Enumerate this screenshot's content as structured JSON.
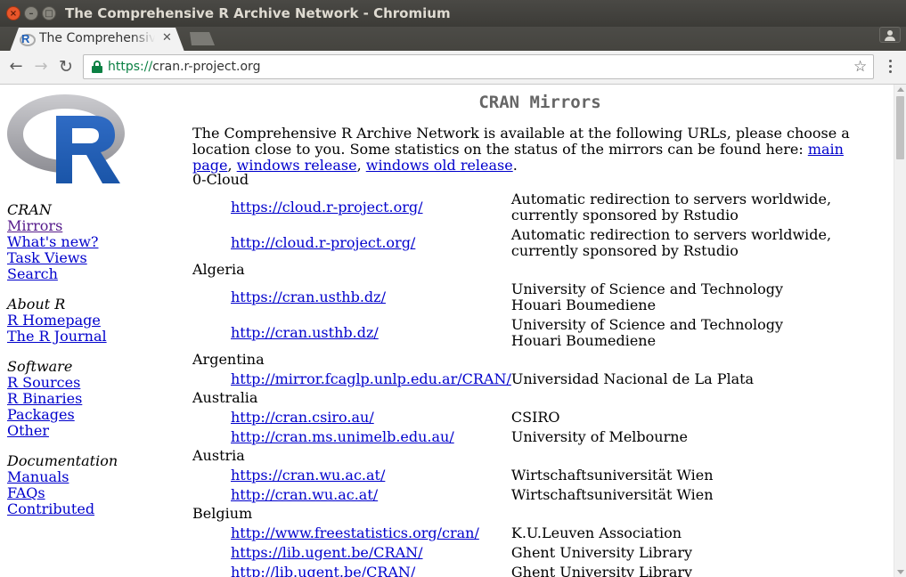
{
  "window": {
    "title": "The Comprehensive R Archive Network - Chromium"
  },
  "tab": {
    "title": "The Comprehensive R Archive Network",
    "favicon": "R"
  },
  "toolbar": {
    "url_scheme": "https://",
    "url_host": "cran.r-project.org"
  },
  "sidebar": {
    "groups": [
      {
        "heading": "CRAN",
        "links": [
          "Mirrors",
          "What's new?",
          "Task Views",
          "Search"
        ]
      },
      {
        "heading": "About R",
        "links": [
          "R Homepage",
          "The R Journal"
        ]
      },
      {
        "heading": "Software",
        "links": [
          "R Sources",
          "R Binaries",
          "Packages",
          "Other"
        ]
      },
      {
        "heading": "Documentation",
        "links": [
          "Manuals",
          "FAQs",
          "Contributed"
        ]
      }
    ]
  },
  "main": {
    "title": "CRAN Mirrors",
    "intro_text": "The Comprehensive R Archive Network is available at the following URLs, please choose a location close to you. Some statistics on the status of the mirrors can be found here: ",
    "intro_links": [
      "main page",
      "windows release",
      "windows old release"
    ],
    "intro_sep1": ", ",
    "intro_sep2": ", ",
    "intro_end": "."
  },
  "mirrors": [
    {
      "country": "0-Cloud",
      "entries": [
        {
          "url": "https://cloud.r-project.org/",
          "desc": "Automatic redirection to servers worldwide, currently sponsored by Rstudio"
        },
        {
          "url": "http://cloud.r-project.org/",
          "desc": "Automatic redirection to servers worldwide, currently sponsored by Rstudio"
        }
      ]
    },
    {
      "country": "Algeria",
      "entries": [
        {
          "url": "https://cran.usthb.dz/",
          "desc": "University of Science and Technology Houari Boumediene"
        },
        {
          "url": "http://cran.usthb.dz/",
          "desc": "University of Science and Technology Houari Boumediene"
        }
      ]
    },
    {
      "country": "Argentina",
      "entries": [
        {
          "url": "http://mirror.fcaglp.unlp.edu.ar/CRAN/",
          "desc": "Universidad Nacional de La Plata"
        }
      ]
    },
    {
      "country": "Australia",
      "entries": [
        {
          "url": "http://cran.csiro.au/",
          "desc": "CSIRO"
        },
        {
          "url": "http://cran.ms.unimelb.edu.au/",
          "desc": "University of Melbourne"
        }
      ]
    },
    {
      "country": "Austria",
      "entries": [
        {
          "url": "https://cran.wu.ac.at/",
          "desc": "Wirtschaftsuniversität Wien"
        },
        {
          "url": "http://cran.wu.ac.at/",
          "desc": "Wirtschaftsuniversität Wien"
        }
      ]
    },
    {
      "country": "Belgium",
      "entries": [
        {
          "url": "http://www.freestatistics.org/cran/",
          "desc": "K.U.Leuven Association"
        },
        {
          "url": "https://lib.ugent.be/CRAN/",
          "desc": "Ghent University Library"
        },
        {
          "url": "http://lib.ugent.be/CRAN/",
          "desc": "Ghent University Library"
        }
      ]
    }
  ],
  "colors": {
    "link": "#0000cc",
    "visited_link": "#551a8b",
    "title_gray": "#666666",
    "secure_green": "#0b8043",
    "r_blue": "#2060b8"
  },
  "icons": {
    "back": "back-arrow-icon",
    "forward": "forward-arrow-icon",
    "reload": "reload-icon",
    "secure": "lock-icon",
    "bookmark": "star-icon",
    "menu": "kebab-menu-icon"
  }
}
